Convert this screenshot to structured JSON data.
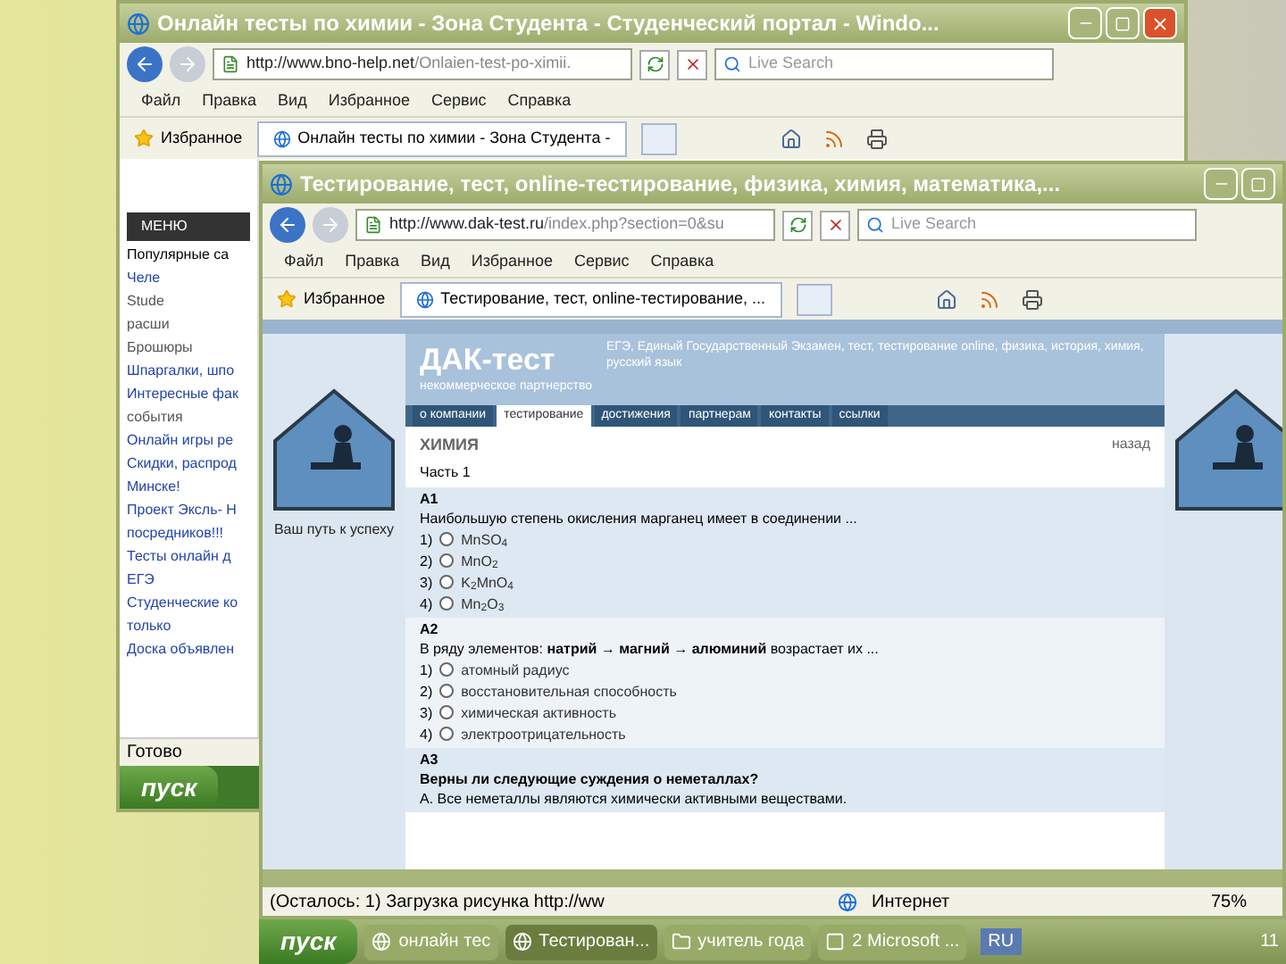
{
  "back_window": {
    "title": "Онлайн тесты по химии - Зона Студента - Студенческий портал - Windo...",
    "address_host": "http://www.bno-help.net",
    "address_path": "/Onlaien-test-po-ximii.",
    "search_placeholder": "Live Search",
    "menu": [
      "Файл",
      "Правка",
      "Вид",
      "Избранное",
      "Сервис",
      "Справка"
    ],
    "favorites": "Избранное",
    "tabs": [
      {
        "label": "Онлайн тесты по химии - Зона Студента -",
        "selected": true
      }
    ],
    "sidebar": {
      "menu_tab": "МЕНЮ",
      "heading": "Популярные са",
      "items": [
        {
          "kind": "link",
          "text": "Челе"
        },
        {
          "kind": "plain",
          "text": "Stude"
        },
        {
          "kind": "plain",
          "text": "расши"
        },
        {
          "kind": "plain",
          "text": "Брошюры"
        },
        {
          "kind": "link",
          "text": "Шпаргалки, шпо"
        },
        {
          "kind": "link",
          "text": "Интересные фак"
        },
        {
          "kind": "plain",
          "text": "события"
        },
        {
          "kind": "link",
          "text": "Онлайн игры ре"
        },
        {
          "kind": "link",
          "text": "Скидки, распрод"
        },
        {
          "kind": "link",
          "text": "Минске!"
        },
        {
          "kind": "link",
          "text": "Проект Эксль- Н"
        },
        {
          "kind": "link",
          "text": "посредников!!!"
        },
        {
          "kind": "link",
          "text": "Тесты онлайн д"
        },
        {
          "kind": "link",
          "text": "ЕГЭ"
        },
        {
          "kind": "link",
          "text": "Студенческие ко"
        },
        {
          "kind": "link",
          "text": "только"
        },
        {
          "kind": "link",
          "text": "Доска объявлен"
        }
      ]
    },
    "status": "Готово",
    "start": "пуск"
  },
  "front_window": {
    "title": "Тестирование, тест, online-тестирование, физика, химия, математика,...",
    "address_host": "http://www.dak-test.ru",
    "address_path": "/index.php?section=0&su",
    "search_placeholder": "Live Search",
    "menu": [
      "Файл",
      "Правка",
      "Вид",
      "Избранное",
      "Сервис",
      "Справка"
    ],
    "favorites": "Избранное",
    "tabs": [
      {
        "label": "Тестирование, тест, online-тестирование, ...",
        "selected": true
      }
    ],
    "page": {
      "logo": "ДАК-тест",
      "logo_subtitle": "некоммерческое партнерство",
      "tagline": "ЕГЭ, Единый Государственный Экзамен, тест, тестирование online, физика, история, химия, русский язык",
      "banner_caption": "Ваш путь к успеху",
      "nav": [
        {
          "label": "о компании",
          "selected": false
        },
        {
          "label": "тестирование",
          "selected": true
        },
        {
          "label": "достижения",
          "selected": false
        },
        {
          "label": "партнерам",
          "selected": false
        },
        {
          "label": "контакты",
          "selected": false
        },
        {
          "label": "ссылки",
          "selected": false
        }
      ],
      "subject": "ХИМИЯ",
      "back_link": "назад",
      "part": "Часть 1",
      "questions": [
        {
          "number": "A1",
          "text": "Наибольшую степень окисления марганец имеет в соединении ...",
          "options": [
            {
              "label": "1)",
              "text": "MnSO$_{4}$",
              "selected": false
            },
            {
              "label": "2)",
              "text": "MnO$_{2}$",
              "selected": false
            },
            {
              "label": "3)",
              "text": "K$_{2}$MnO$_{4}$",
              "selected": false
            },
            {
              "label": "4)",
              "text": "Mn$_{2}$O$_{3}$",
              "selected": false
            }
          ]
        },
        {
          "number": "A2",
          "text": "В ряду элементов: **натрий** → **магний** → **алюминий** возрастает их ...",
          "options": [
            {
              "label": "1)",
              "text": "атомный радиус",
              "selected": false
            },
            {
              "label": "2)",
              "text": "восстановительная способность",
              "selected": false
            },
            {
              "label": "3)",
              "text": "химическая активность",
              "selected": false
            },
            {
              "label": "4)",
              "text": "электроотрицательность",
              "selected": false
            }
          ]
        },
        {
          "number": "A3",
          "text": "**Верны ли следующие суждения о неметаллах?**",
          "note": "А. Все неметаллы являются химически активными веществами."
        }
      ]
    },
    "status_bar": {
      "message": "(Осталось: 1) Загрузка рисунка http://ww",
      "zone": "Интернет",
      "zoom": "75%"
    }
  },
  "taskbar": {
    "start": "пуск",
    "tasks": [
      {
        "label": "онлайн тес",
        "kind": "browser",
        "selected": false
      },
      {
        "label": "Тестирован...",
        "kind": "browser",
        "selected": true
      },
      {
        "label": "учитель года",
        "kind": "folder",
        "selected": false
      },
      {
        "label": "2 Microsoft ...",
        "kind": "app",
        "selected": false
      }
    ],
    "language": "RU",
    "clock": "11"
  }
}
